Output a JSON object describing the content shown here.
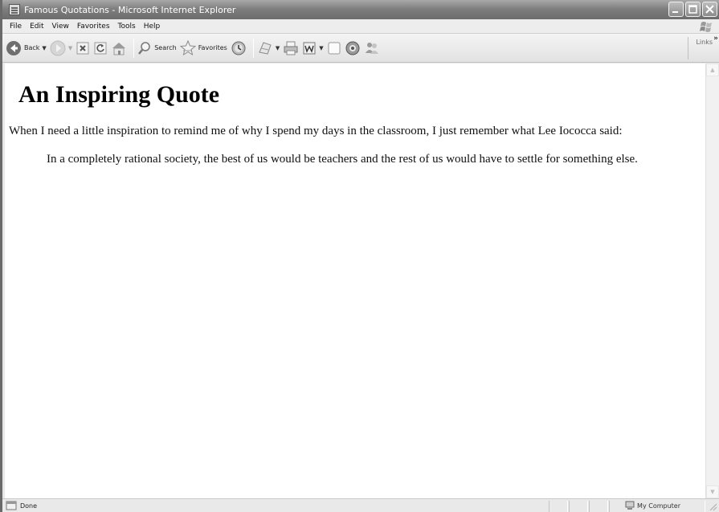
{
  "window": {
    "title": "Famous Quotations - Microsoft Internet Explorer",
    "icon": "ie-page-icon"
  },
  "menu": {
    "items": [
      {
        "label": "File"
      },
      {
        "label": "Edit"
      },
      {
        "label": "View"
      },
      {
        "label": "Favorites"
      },
      {
        "label": "Tools"
      },
      {
        "label": "Help"
      }
    ]
  },
  "toolbar": {
    "back_label": "Back",
    "search_label": "Search",
    "favorites_label": "Favorites",
    "links_label": "Links",
    "links_chevron": "»"
  },
  "page": {
    "heading": "An Inspiring Quote",
    "intro": "When I need a little inspiration to remind me of why I spend my days in the classroom, I just remember what Lee Iococca said:",
    "quote": "In a completely rational society, the best of us would be teachers and the rest of us would have to settle for something else."
  },
  "status": {
    "text": "Done",
    "zone": "My Computer"
  }
}
